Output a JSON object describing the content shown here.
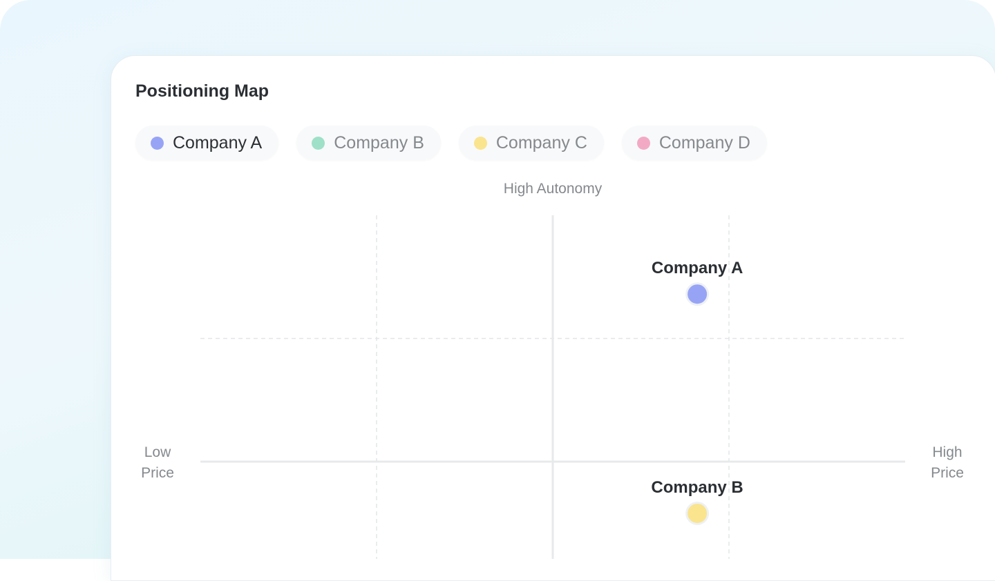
{
  "title": "Positioning Map",
  "legend": [
    {
      "label": "Company A",
      "color": "#97a4f6",
      "active": true
    },
    {
      "label": "Company B",
      "color": "#9ee0c8",
      "active": false
    },
    {
      "label": "Company C",
      "color": "#fae48e",
      "active": false
    },
    {
      "label": "Company D",
      "color": "#f2aac4",
      "active": false
    }
  ],
  "axes": {
    "top": "High Autonomy",
    "left_line1": "Low",
    "left_line2": "Price",
    "right_line1": "High",
    "right_line2": "Price"
  },
  "chart_data": {
    "type": "scatter",
    "title": "Positioning Map",
    "xlabel_left": "Low Price",
    "xlabel_right": "High Price",
    "ylabel_top": "High Autonomy",
    "xlim": [
      -1,
      1
    ],
    "ylim": [
      -1,
      1
    ],
    "grid": true,
    "legend_position": "top-left",
    "points": [
      {
        "label": "Company A",
        "x": 0.41,
        "y": 0.68,
        "color": "#97a4f6"
      },
      {
        "label": "Company B",
        "x": 0.41,
        "y": -0.21,
        "color": "#fae48e"
      }
    ]
  }
}
